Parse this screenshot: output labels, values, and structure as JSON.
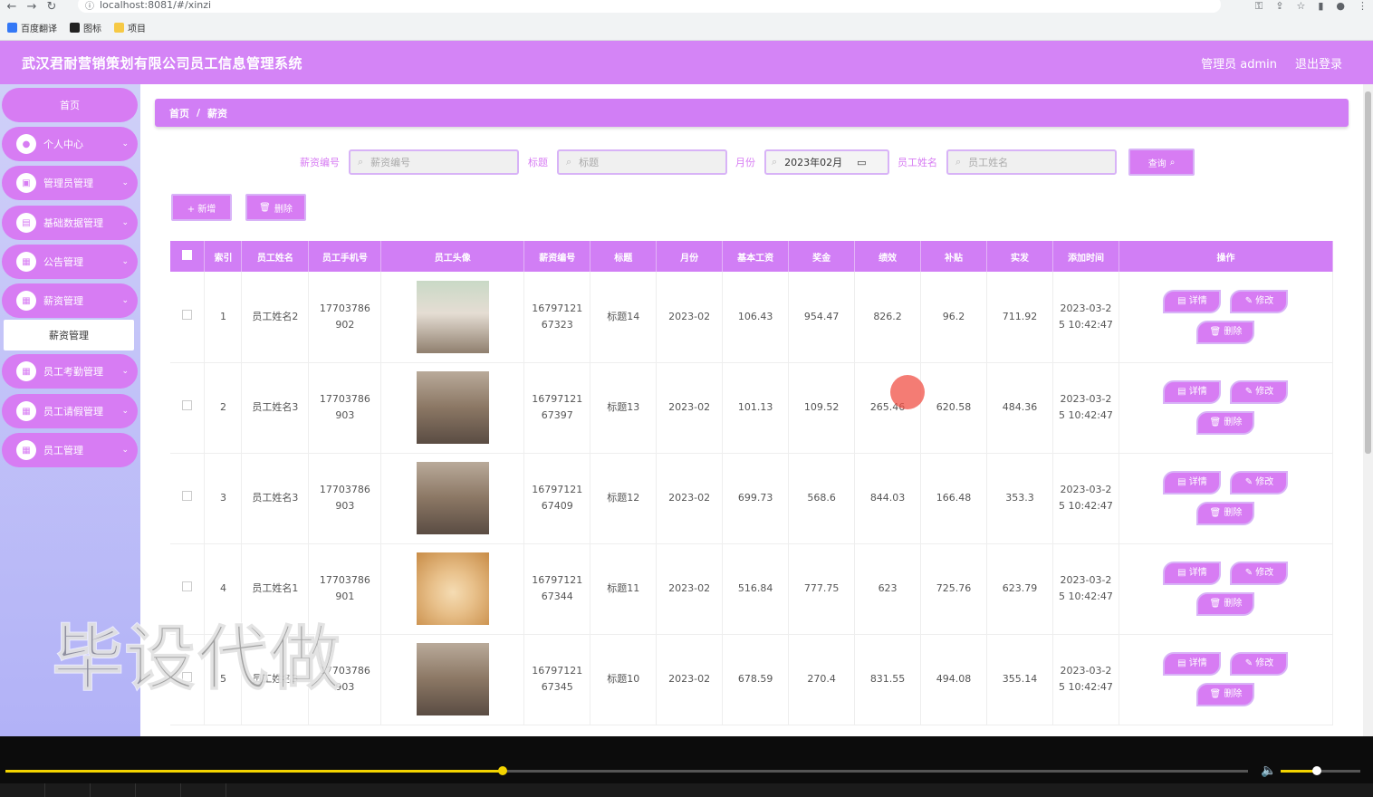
{
  "browser": {
    "url": "localhost:8081/#/xinzi",
    "bookmarks": [
      "百度翻译",
      "图标",
      "项目"
    ]
  },
  "header": {
    "title": "武汉君耐营销策划有限公司员工信息管理系统",
    "user": "管理员 admin",
    "logout": "退出登录"
  },
  "sidebar": {
    "home": "首页",
    "items": [
      "个人中心",
      "管理员管理",
      "基础数据管理",
      "公告管理",
      "薪资管理",
      "员工考勤管理",
      "员工请假管理",
      "员工管理"
    ],
    "submenu": "薪资管理"
  },
  "breadcrumb": {
    "home": "首页",
    "sep": "/",
    "current": "薪资"
  },
  "filters": {
    "salary_no_label": "薪资编号",
    "salary_no_placeholder": "薪资编号",
    "title_label": "标题",
    "title_placeholder": "标题",
    "month_label": "月份",
    "month_value": "2023年02月",
    "name_label": "员工姓名",
    "name_placeholder": "员工姓名",
    "query": "查询"
  },
  "actions": {
    "add": "+ 新增",
    "delete": "删除"
  },
  "table": {
    "headers": [
      "",
      "索引",
      "员工姓名",
      "员工手机号",
      "员工头像",
      "薪资编号",
      "标题",
      "月份",
      "基本工资",
      "奖金",
      "绩效",
      "补贴",
      "实发",
      "添加时间",
      "操作"
    ],
    "op_detail": "详情",
    "op_edit": "修改",
    "op_delete": "删除",
    "rows": [
      {
        "idx": "1",
        "name": "员工姓名2",
        "phone1": "17703786",
        "phone2": "902",
        "avatar": "woman",
        "no1": "16797121",
        "no2": "67323",
        "title": "标题14",
        "month": "2023-02",
        "base": "106.43",
        "bonus": "954.47",
        "perf": "826.2",
        "sub": "96.2",
        "net": "711.92",
        "t1": "2023-03-2",
        "t2": "5 10:42:47"
      },
      {
        "idx": "2",
        "name": "员工姓名3",
        "phone1": "17703786",
        "phone2": "903",
        "avatar": "man",
        "no1": "16797121",
        "no2": "67397",
        "title": "标题13",
        "month": "2023-02",
        "base": "101.13",
        "bonus": "109.52",
        "perf": "265.46",
        "sub": "620.58",
        "net": "484.36",
        "t1": "2023-03-2",
        "t2": "5 10:42:47"
      },
      {
        "idx": "3",
        "name": "员工姓名3",
        "phone1": "17703786",
        "phone2": "903",
        "avatar": "man",
        "no1": "16797121",
        "no2": "67409",
        "title": "标题12",
        "month": "2023-02",
        "base": "699.73",
        "bonus": "568.6",
        "perf": "844.03",
        "sub": "166.48",
        "net": "353.3",
        "t1": "2023-03-2",
        "t2": "5 10:42:47"
      },
      {
        "idx": "4",
        "name": "员工姓名1",
        "phone1": "17703786",
        "phone2": "901",
        "avatar": "dog",
        "no1": "16797121",
        "no2": "67344",
        "title": "标题11",
        "month": "2023-02",
        "base": "516.84",
        "bonus": "777.75",
        "perf": "623",
        "sub": "725.76",
        "net": "623.79",
        "t1": "2023-03-2",
        "t2": "5 10:42:47"
      },
      {
        "idx": "5",
        "name": "员工姓名3",
        "phone1": "17703786",
        "phone2": "903",
        "avatar": "man",
        "no1": "16797121",
        "no2": "67345",
        "title": "标题10",
        "month": "2023-02",
        "base": "678.59",
        "bonus": "270.4",
        "perf": "831.55",
        "sub": "494.08",
        "net": "355.14",
        "t1": "2023-03-2",
        "t2": "5 10:42:47"
      }
    ]
  },
  "watermark": "毕设代做",
  "player": {
    "progress": 0.4,
    "volume": 0.45
  },
  "colors": {
    "accent": "#d77cf3",
    "header": "#d484f6",
    "sidebar_top": "#cfd0f8",
    "sidebar_bottom": "#b2b2f7"
  }
}
